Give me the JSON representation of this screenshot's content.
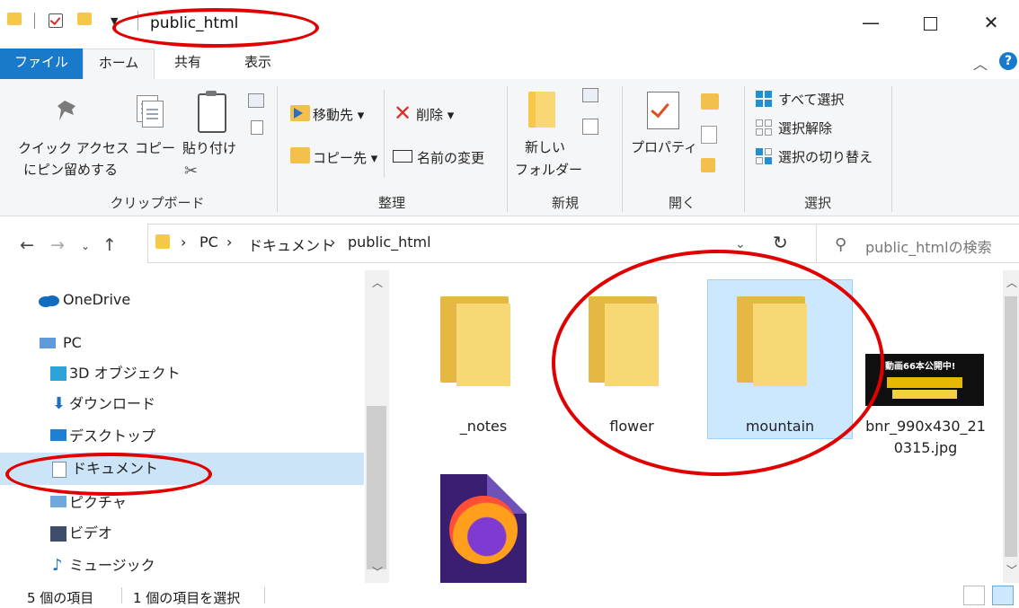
{
  "window": {
    "title": "public_html",
    "minimize": "—",
    "close": "✕"
  },
  "ribbon_tabs": [
    "ファイル",
    "ホーム",
    "共有",
    "表示"
  ],
  "ribbon": {
    "clipboard": {
      "pin_line1": "クイック アクセス",
      "pin_line2": "にピン留めする",
      "copy": "コピー",
      "paste": "貼り付け",
      "group": "クリップボード"
    },
    "organize": {
      "move_to": "移動先 ▾",
      "copy_to": "コピー先 ▾",
      "delete": "削除 ▾",
      "rename": "名前の変更",
      "group": "整理"
    },
    "new": {
      "new_folder_line1": "新しい",
      "new_folder_line2": "フォルダー",
      "group": "新規"
    },
    "open": {
      "properties": "プロパティ",
      "group": "開く"
    },
    "select": {
      "select_all": "すべて選択",
      "select_none": "選択解除",
      "invert": "選択の切り替え",
      "group": "選択"
    }
  },
  "address": {
    "breadcrumb": [
      "PC",
      "ドキュメント",
      "public_html"
    ],
    "separator": "›",
    "search_placeholder": "public_htmlの検索"
  },
  "nav": {
    "items": [
      {
        "label": "OneDrive"
      },
      {
        "label": "PC"
      },
      {
        "label": "3D オブジェクト"
      },
      {
        "label": "ダウンロード"
      },
      {
        "label": "デスクトップ"
      },
      {
        "label": "ドキュメント"
      },
      {
        "label": "ピクチャ"
      },
      {
        "label": "ビデオ"
      },
      {
        "label": "ミュージック"
      }
    ]
  },
  "files": [
    {
      "name": "_notes",
      "type": "folder"
    },
    {
      "name": "flower",
      "type": "folder"
    },
    {
      "name": "mountain",
      "type": "folder",
      "selected": true
    },
    {
      "name_line1": "bnr_990x430_21",
      "name_line2": "0315.jpg",
      "type": "image",
      "thumb_text": "動画66本公開中!"
    },
    {
      "name": "",
      "type": "firefox-html"
    }
  ],
  "status": {
    "item_count": "5 個の項目",
    "selected": "1 個の項目を選択"
  },
  "colors": {
    "accent": "#1979ca",
    "selection": "#cce8ff",
    "annotation": "#e00000",
    "folder": "#f8d775"
  }
}
